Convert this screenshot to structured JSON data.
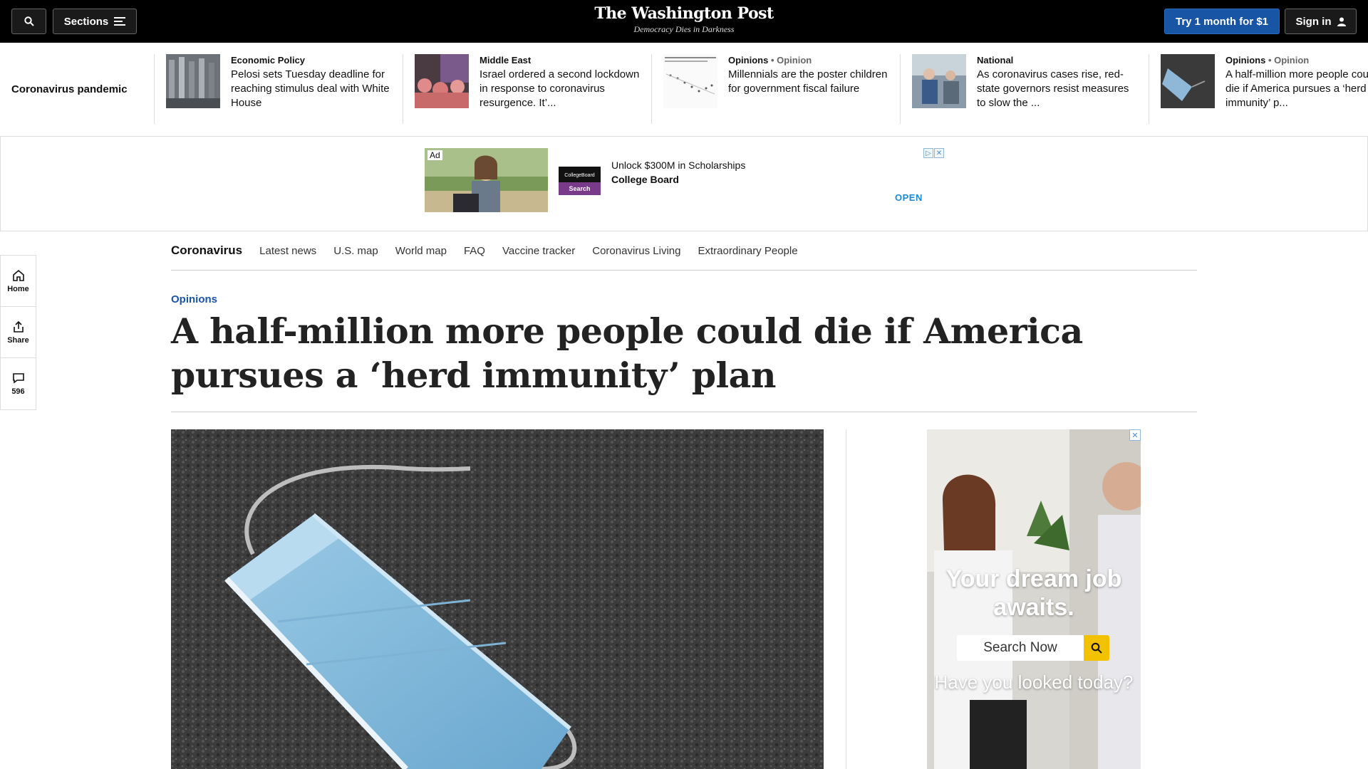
{
  "topbar": {
    "sections_label": "Sections",
    "brand_name": "The Washington Post",
    "brand_tagline": "Democracy Dies in Darkness",
    "subscribe_label": "Try 1 month for $1",
    "signin_label": "Sign in"
  },
  "rail": {
    "label": "Coronavirus pandemic",
    "items": [
      {
        "kicker": "Economic Policy",
        "kicker_opinion": "",
        "headline": "Pelosi sets Tuesday deadline for reaching stimulus deal with White House"
      },
      {
        "kicker": "Middle East",
        "kicker_opinion": "",
        "headline": "Israel ordered a second lockdown in response to coronavirus resurgence. It’..."
      },
      {
        "kicker": "Opinions",
        "kicker_opinion": "• Opinion",
        "headline": "Millennials are the poster children for government fiscal failure"
      },
      {
        "kicker": "National",
        "kicker_opinion": "",
        "headline": "As coronavirus cases rise, red-state governors resist measures to slow the ..."
      },
      {
        "kicker": "Opinions",
        "kicker_opinion": "• Opinion",
        "headline": "A half-million more people could die if America pursues a ‘herd immunity’ p..."
      }
    ]
  },
  "top_ad": {
    "ad_tag": "Ad",
    "logo_text": "CollegeBoard",
    "logo_button": "Search",
    "line1": "Unlock $300M in Scholarships",
    "line2": "College Board",
    "open_label": "OPEN"
  },
  "section_nav": {
    "title": "Coronavirus",
    "links": [
      "Latest news",
      "U.S. map",
      "World map",
      "FAQ",
      "Vaccine tracker",
      "Coronavirus Living",
      "Extraordinary People"
    ]
  },
  "side_rail": {
    "home_label": "Home",
    "share_label": "Share",
    "comments_count": "596"
  },
  "article": {
    "kicker": "Opinions",
    "headline": "A half-million more people could die if America pursues a ‘herd immunity’ plan"
  },
  "right_ad": {
    "headline": "Your dream job awaits.",
    "search_label": "Search Now",
    "tagline": "Have you looked today?"
  },
  "colors": {
    "brand_blue": "#1955a5",
    "topbar_bg": "#000000",
    "open_blue": "#1a8ad4"
  }
}
